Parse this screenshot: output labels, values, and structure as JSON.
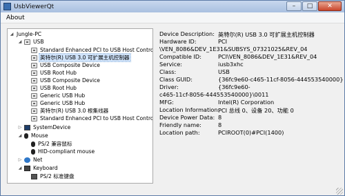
{
  "window": {
    "title": "UsbViewerQt",
    "btn_min": "–",
    "btn_max": "□",
    "btn_close": "✕"
  },
  "menu": {
    "about": "About"
  },
  "tree": {
    "root": "Jungle-PC",
    "usb": "USB",
    "usb_items": [
      "Standard Enhanced PCI to USB Host Controller",
      "英特尔(R) USB 3.0 可扩展主机控制器",
      "USB Composite Device",
      "USB Root Hub",
      "USB Composite Device",
      "USB Root Hub",
      "Generic USB Hub",
      "Generic USB Hub",
      "英特尔(R) USB 3.0 根集线器",
      "Standard Enhanced PCI to USB Host Controller"
    ],
    "system_device": "SystemDevice",
    "mouse": "Mouse",
    "mouse_items": [
      "PS/2 兼容鼠标",
      "HID-compliant mouse"
    ],
    "net": "Net",
    "keyboard": "Keyboard",
    "keyboard_items": [
      "PS/2 标准键盘"
    ]
  },
  "properties": {
    "device_description": {
      "label": "Device Description:",
      "value": "英特尔(R) USB 3.0 可扩展主机控制器"
    },
    "hardware_id": {
      "label": "Hardware ID:",
      "value": "PCI",
      "cont": "\\VEN_8086&DEV_1E31&SUBSYS_07321025&REV_04"
    },
    "compatible_id": {
      "label": "Compatible ID:",
      "value": "PCI\\VEN_8086&DEV_1E31&REV_04"
    },
    "service": {
      "label": "Service:",
      "value": "iusb3xhc"
    },
    "class": {
      "label": "Class:",
      "value": "USB"
    },
    "class_guid": {
      "label": "Class GUID:",
      "value": "{36fc9e60-c465-11cf-8056-444553540000}"
    },
    "driver": {
      "label": "Driver:",
      "value": "{36fc9e60-",
      "cont": "c465-11cf-8056-444553540000}\\0011"
    },
    "mfg": {
      "label": "MFG:",
      "value": "Intel(R) Corporation"
    },
    "location_information": {
      "label": "Location Information:",
      "value": "PCI 总线 0、设备 20、功能 0"
    },
    "device_power_data": {
      "label": "Device Power Data:",
      "value": "8"
    },
    "friendly_name": {
      "label": "Friendly name:",
      "value": "8"
    },
    "location_path": {
      "label": "Location path:",
      "value": "PCIROOT(0)#PCI(1400)"
    }
  }
}
